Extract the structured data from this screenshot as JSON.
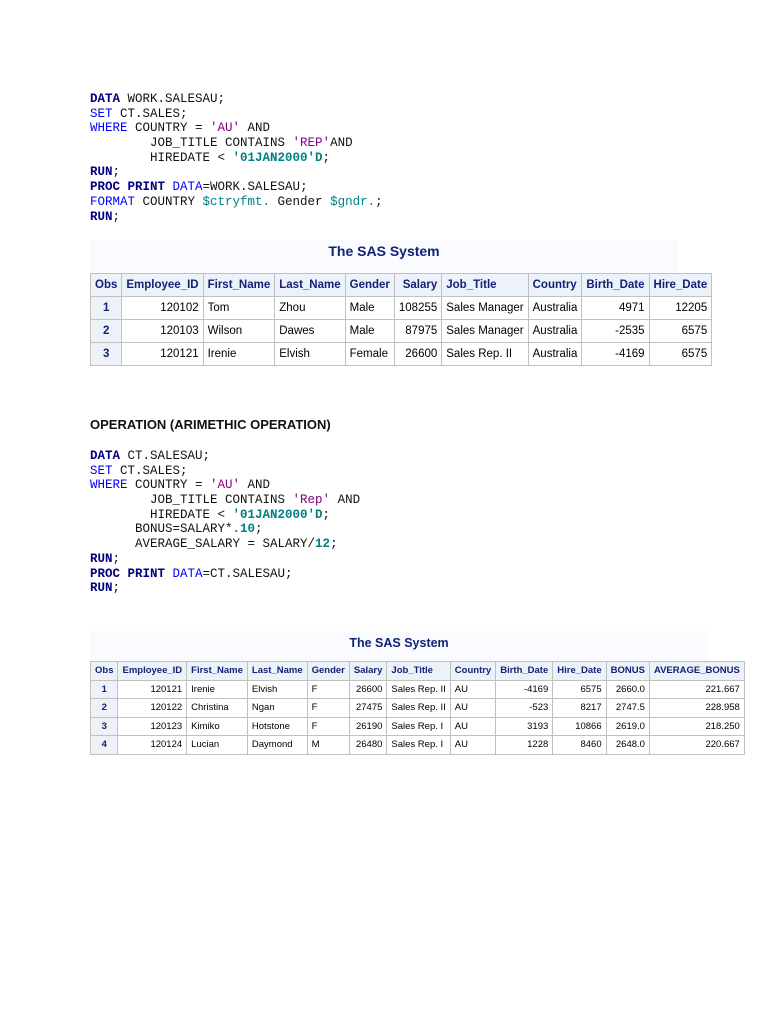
{
  "code_block_1": [
    [
      [
        "DATA",
        "kw"
      ],
      [
        " WORK.SALESAU;",
        ""
      ]
    ],
    [
      [
        "SET",
        "bkw"
      ],
      [
        " CT.SALES;",
        ""
      ]
    ],
    [
      [
        "WHERE",
        "bkw"
      ],
      [
        " COUNTRY = ",
        ""
      ],
      [
        "'AU'",
        "str"
      ],
      [
        " AND",
        ""
      ]
    ],
    [
      [
        "        JOB_TITLE CONTAINS ",
        ""
      ],
      [
        "'REP'",
        "str"
      ],
      [
        "AND",
        ""
      ]
    ],
    [
      [
        "        HIREDATE < ",
        ""
      ],
      [
        "'01JAN2000'D",
        "num"
      ],
      [
        ";",
        ""
      ]
    ],
    [
      [
        "RUN",
        "kw"
      ],
      [
        ";",
        ""
      ]
    ],
    [
      [
        "PROC PRINT",
        "kw"
      ],
      [
        " ",
        ""
      ],
      [
        "DATA",
        "bkw"
      ],
      [
        "=WORK.SALESAU;",
        ""
      ]
    ],
    [
      [
        "FORMAT",
        "bkw"
      ],
      [
        " COUNTRY ",
        ""
      ],
      [
        "$ctryfmt.",
        "fmt"
      ],
      [
        " Gender ",
        ""
      ],
      [
        "$gndr.",
        "fmt"
      ],
      [
        ";",
        ""
      ]
    ],
    [
      [
        "RUN",
        "kw"
      ],
      [
        ";",
        ""
      ]
    ]
  ],
  "table_1": {
    "title": "The SAS System",
    "columns": [
      "Obs",
      "Employee_ID",
      "First_Name",
      "Last_Name",
      "Gender",
      "Salary",
      "Job_Title",
      "Country",
      "Birth_Date",
      "Hire_Date"
    ],
    "rows": [
      [
        "1",
        "120102",
        "Tom",
        "Zhou",
        "Male",
        "108255",
        "Sales Manager",
        "Australia",
        "4971",
        "12205"
      ],
      [
        "2",
        "120103",
        "Wilson",
        "Dawes",
        "Male",
        "87975",
        "Sales Manager",
        "Australia",
        "-2535",
        "6575"
      ],
      [
        "3",
        "120121",
        "Irenie",
        "Elvish",
        "Female",
        "26600",
        "Sales Rep. II",
        "Australia",
        "-4169",
        "6575"
      ]
    ]
  },
  "section_heading": "OPERATION (ARIMETHIC OPERATION)",
  "code_block_2": [
    [
      [
        "DATA",
        "kw"
      ],
      [
        " CT.SALESAU;",
        ""
      ]
    ],
    [
      [
        "SET",
        "bkw"
      ],
      [
        " CT.SALES;",
        ""
      ]
    ],
    [
      [
        "WHERE",
        "bkw"
      ],
      [
        " COUNTRY = ",
        ""
      ],
      [
        "'AU'",
        "str"
      ],
      [
        " AND",
        ""
      ]
    ],
    [
      [
        "        JOB_TITLE CONTAINS ",
        ""
      ],
      [
        "'Rep'",
        "str"
      ],
      [
        " AND",
        ""
      ]
    ],
    [
      [
        "        HIREDATE < ",
        ""
      ],
      [
        "'01JAN2000'D",
        "num"
      ],
      [
        ";",
        ""
      ]
    ],
    [
      [
        "      BONUS=SALARY*",
        ""
      ],
      [
        ".10",
        "num"
      ],
      [
        ";",
        ""
      ]
    ],
    [
      [
        "      AVERAGE_SALARY = SALARY/",
        ""
      ],
      [
        "12",
        "num"
      ],
      [
        ";",
        ""
      ]
    ],
    [
      [
        "RUN",
        "kw"
      ],
      [
        ";",
        ""
      ]
    ],
    [
      [
        "PROC PRINT",
        "kw"
      ],
      [
        " ",
        ""
      ],
      [
        "DATA",
        "bkw"
      ],
      [
        "=CT.SALESAU;",
        ""
      ]
    ],
    [
      [
        "RUN",
        "kw"
      ],
      [
        ";",
        ""
      ]
    ]
  ],
  "table_2": {
    "title": "The SAS System",
    "columns": [
      "Obs",
      "Employee_ID",
      "First_Name",
      "Last_Name",
      "Gender",
      "Salary",
      "Job_Title",
      "Country",
      "Birth_Date",
      "Hire_Date",
      "BONUS",
      "AVERAGE_BONUS"
    ],
    "rows": [
      [
        "1",
        "120121",
        "Irenie",
        "Elvish",
        "F",
        "26600",
        "Sales Rep. II",
        "AU",
        "-4169",
        "6575",
        "2660.0",
        "221.667"
      ],
      [
        "2",
        "120122",
        "Christina",
        "Ngan",
        "F",
        "27475",
        "Sales Rep. II",
        "AU",
        "-523",
        "8217",
        "2747.5",
        "228.958"
      ],
      [
        "3",
        "120123",
        "Kimiko",
        "Hotstone",
        "F",
        "26190",
        "Sales Rep. I",
        "AU",
        "3193",
        "10866",
        "2619.0",
        "218.250"
      ],
      [
        "4",
        "120124",
        "Lucian",
        "Daymond",
        "M",
        "26480",
        "Sales Rep. I",
        "AU",
        "1228",
        "8460",
        "2648.0",
        "220.667"
      ]
    ]
  }
}
